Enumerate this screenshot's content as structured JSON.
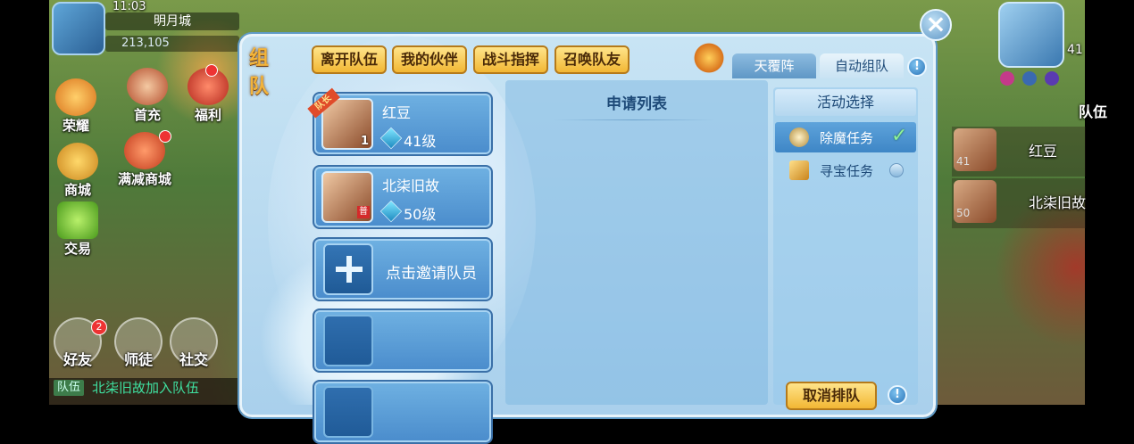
{
  "hud": {
    "time": "11:03",
    "city": "明月城",
    "power": "213,105"
  },
  "side_menu": {
    "honor": "荣耀",
    "first_charge": "首充",
    "welfare": "福利",
    "mall": "商城",
    "treasure_mall": "满减商城",
    "trade": "交易"
  },
  "social": {
    "friends": "好友",
    "friends_badge": "2",
    "master": "师徒",
    "social": "社交"
  },
  "chat": {
    "channel": "队伍",
    "message": "北柒旧故加入队伍"
  },
  "right_hud": {
    "level": "41",
    "team_tab": "队伍",
    "members": [
      {
        "name": "红豆",
        "level": "41"
      },
      {
        "name": "北柒旧故",
        "level": "50"
      }
    ]
  },
  "dialog": {
    "title": "组队",
    "tabs": [
      "离开队伍",
      "我的伙伴",
      "战斗指挥",
      "召唤队友"
    ],
    "formation_tabs": [
      "天覆阵",
      "自动组队"
    ],
    "close": "×",
    "info": "!"
  },
  "team": {
    "members": [
      {
        "name": "红豆",
        "level": "41级",
        "leader_badge": "队长",
        "corner": "1"
      },
      {
        "name": "北柒旧故",
        "level": "50级",
        "corner": "普"
      }
    ],
    "invite": "点击邀请队员"
  },
  "apply_list": {
    "title": "申请列表"
  },
  "activity": {
    "header": "活动选择",
    "items": [
      {
        "label": "除魔任务",
        "selected": true
      },
      {
        "label": "寻宝任务",
        "selected": false
      }
    ],
    "cancel": "取消排队"
  }
}
